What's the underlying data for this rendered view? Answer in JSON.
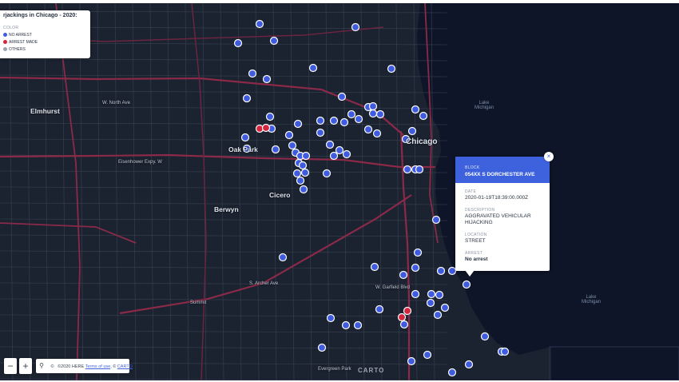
{
  "legend": {
    "title": "rjackings in Chicago - 2020:",
    "subtitle": "COLOR",
    "items": [
      {
        "label": "NO ARREST",
        "color": "#3f5be0"
      },
      {
        "label": "ARREST MADE",
        "color": "#d5243c"
      },
      {
        "label": "OTHERS",
        "color": "#9aa3ae"
      }
    ]
  },
  "popup": {
    "block_key": "BLOCK",
    "block_value": "054XX S DORCHESTER AVE",
    "date_key": "DATE",
    "date_value": "2020-01-19T18:39:00.000Z",
    "description_key": "DESCRIPTION",
    "description_value": "AGGRAVATED VEHICULAR HIJACKING",
    "location_key": "LOCATION",
    "location_value": "STREET",
    "arrest_key": "ARREST",
    "arrest_value": "No arrest",
    "close_glyph": "×"
  },
  "controls": {
    "zoom_in": "+",
    "zoom_out": "−",
    "search": "⚲",
    "copyright_icon": "©",
    "attribution_prefix": "©2020 HERE",
    "terms_link": "Terms of use",
    "attribution_mid": ", ©",
    "carto_link": "CARTO",
    "watermark": "CARTO"
  },
  "map_labels": {
    "chicago": "Chicago",
    "oak_park": "Oak Park",
    "cicero": "Cicero",
    "berwyn": "Berwyn",
    "elmhurst": "Elmhurst",
    "evergreen_park": "Evergreen Park",
    "lake_michigan": "Lake\nMichigan",
    "lake_michigan_2": "Lake\nMichigan",
    "north_ave": "W. North Ave",
    "eisenhower": "Eisenhower Expy. W",
    "archer_ave": "S. Archer Ave",
    "garfield": "W. Garfield Blvd",
    "summit": "Summit"
  },
  "incidents": {
    "no_arrest_color": "#3f5be0",
    "arrest_color": "#d5243c",
    "arrest_made_count": 4
  },
  "colors": {
    "water": "#0e1528",
    "land": "#1b2230",
    "roads_major": "#8a2a48",
    "roads_minor": "#3a4252",
    "accent": "#3e62dd"
  }
}
